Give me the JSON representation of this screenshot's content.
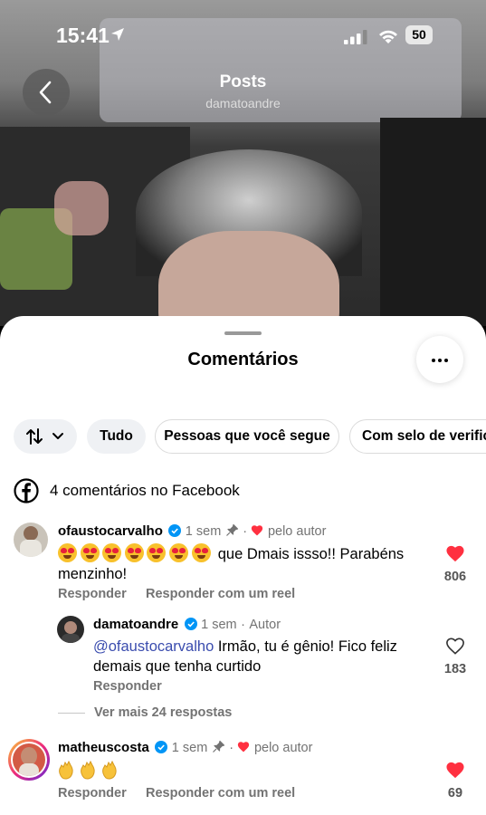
{
  "status_bar": {
    "time": "15:41",
    "battery": "50"
  },
  "header": {
    "title": "Posts",
    "username": "damatoandre"
  },
  "sheet": {
    "title": "Comentários"
  },
  "filters": [
    "Tudo",
    "Pessoas que você segue",
    "Com selo de verificação"
  ],
  "facebook": {
    "text": "4 comentários no Facebook"
  },
  "comments": [
    {
      "username": "ofaustocarvalho",
      "time": "1 sem",
      "liked_by": "pelo autor",
      "text": "que Dmais issso!! Parabéns menzinho!",
      "reply_label": "Responder",
      "reel_label": "Responder com um reel",
      "likes": "806",
      "replies": [
        {
          "username": "damatoandre",
          "time": "1 sem",
          "role": "Autor",
          "mention": "@ofaustocarvalho",
          "text": "Irmão, tu é gênio! Fico feliz demais que tenha curtido",
          "reply_label": "Responder",
          "likes": "183"
        }
      ],
      "more_replies": "Ver mais 24 respostas"
    },
    {
      "username": "matheuscosta",
      "time": "1 sem",
      "liked_by": "pelo autor",
      "reply_label": "Responder",
      "reel_label": "Responder com um reel",
      "likes": "69"
    }
  ],
  "colors": {
    "heart": "#ff3040",
    "verified": "#0095f6",
    "mention": "#3a4cae"
  },
  "icons": [
    "location-arrow-icon",
    "signal-icon",
    "wifi-icon",
    "battery-icon",
    "back-chevron-icon",
    "more-icon",
    "sort-icon",
    "chevron-down-icon",
    "facebook-icon",
    "verified-icon",
    "pin-icon",
    "heart-icon"
  ]
}
